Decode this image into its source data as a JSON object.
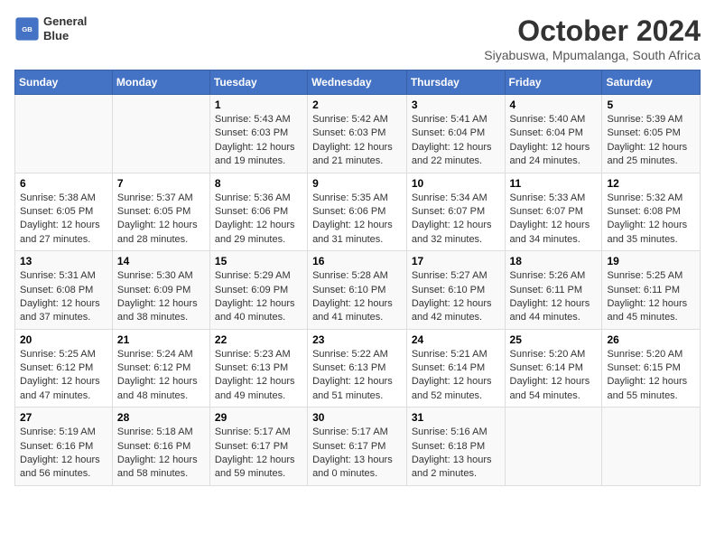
{
  "logo": {
    "line1": "General",
    "line2": "Blue"
  },
  "title": "October 2024",
  "subtitle": "Siyabuswa, Mpumalanga, South Africa",
  "weekdays": [
    "Sunday",
    "Monday",
    "Tuesday",
    "Wednesday",
    "Thursday",
    "Friday",
    "Saturday"
  ],
  "weeks": [
    [
      {
        "day": "",
        "info": ""
      },
      {
        "day": "",
        "info": ""
      },
      {
        "day": "1",
        "info": "Sunrise: 5:43 AM\nSunset: 6:03 PM\nDaylight: 12 hours\nand 19 minutes."
      },
      {
        "day": "2",
        "info": "Sunrise: 5:42 AM\nSunset: 6:03 PM\nDaylight: 12 hours\nand 21 minutes."
      },
      {
        "day": "3",
        "info": "Sunrise: 5:41 AM\nSunset: 6:04 PM\nDaylight: 12 hours\nand 22 minutes."
      },
      {
        "day": "4",
        "info": "Sunrise: 5:40 AM\nSunset: 6:04 PM\nDaylight: 12 hours\nand 24 minutes."
      },
      {
        "day": "5",
        "info": "Sunrise: 5:39 AM\nSunset: 6:05 PM\nDaylight: 12 hours\nand 25 minutes."
      }
    ],
    [
      {
        "day": "6",
        "info": "Sunrise: 5:38 AM\nSunset: 6:05 PM\nDaylight: 12 hours\nand 27 minutes."
      },
      {
        "day": "7",
        "info": "Sunrise: 5:37 AM\nSunset: 6:05 PM\nDaylight: 12 hours\nand 28 minutes."
      },
      {
        "day": "8",
        "info": "Sunrise: 5:36 AM\nSunset: 6:06 PM\nDaylight: 12 hours\nand 29 minutes."
      },
      {
        "day": "9",
        "info": "Sunrise: 5:35 AM\nSunset: 6:06 PM\nDaylight: 12 hours\nand 31 minutes."
      },
      {
        "day": "10",
        "info": "Sunrise: 5:34 AM\nSunset: 6:07 PM\nDaylight: 12 hours\nand 32 minutes."
      },
      {
        "day": "11",
        "info": "Sunrise: 5:33 AM\nSunset: 6:07 PM\nDaylight: 12 hours\nand 34 minutes."
      },
      {
        "day": "12",
        "info": "Sunrise: 5:32 AM\nSunset: 6:08 PM\nDaylight: 12 hours\nand 35 minutes."
      }
    ],
    [
      {
        "day": "13",
        "info": "Sunrise: 5:31 AM\nSunset: 6:08 PM\nDaylight: 12 hours\nand 37 minutes."
      },
      {
        "day": "14",
        "info": "Sunrise: 5:30 AM\nSunset: 6:09 PM\nDaylight: 12 hours\nand 38 minutes."
      },
      {
        "day": "15",
        "info": "Sunrise: 5:29 AM\nSunset: 6:09 PM\nDaylight: 12 hours\nand 40 minutes."
      },
      {
        "day": "16",
        "info": "Sunrise: 5:28 AM\nSunset: 6:10 PM\nDaylight: 12 hours\nand 41 minutes."
      },
      {
        "day": "17",
        "info": "Sunrise: 5:27 AM\nSunset: 6:10 PM\nDaylight: 12 hours\nand 42 minutes."
      },
      {
        "day": "18",
        "info": "Sunrise: 5:26 AM\nSunset: 6:11 PM\nDaylight: 12 hours\nand 44 minutes."
      },
      {
        "day": "19",
        "info": "Sunrise: 5:25 AM\nSunset: 6:11 PM\nDaylight: 12 hours\nand 45 minutes."
      }
    ],
    [
      {
        "day": "20",
        "info": "Sunrise: 5:25 AM\nSunset: 6:12 PM\nDaylight: 12 hours\nand 47 minutes."
      },
      {
        "day": "21",
        "info": "Sunrise: 5:24 AM\nSunset: 6:12 PM\nDaylight: 12 hours\nand 48 minutes."
      },
      {
        "day": "22",
        "info": "Sunrise: 5:23 AM\nSunset: 6:13 PM\nDaylight: 12 hours\nand 49 minutes."
      },
      {
        "day": "23",
        "info": "Sunrise: 5:22 AM\nSunset: 6:13 PM\nDaylight: 12 hours\nand 51 minutes."
      },
      {
        "day": "24",
        "info": "Sunrise: 5:21 AM\nSunset: 6:14 PM\nDaylight: 12 hours\nand 52 minutes."
      },
      {
        "day": "25",
        "info": "Sunrise: 5:20 AM\nSunset: 6:14 PM\nDaylight: 12 hours\nand 54 minutes."
      },
      {
        "day": "26",
        "info": "Sunrise: 5:20 AM\nSunset: 6:15 PM\nDaylight: 12 hours\nand 55 minutes."
      }
    ],
    [
      {
        "day": "27",
        "info": "Sunrise: 5:19 AM\nSunset: 6:16 PM\nDaylight: 12 hours\nand 56 minutes."
      },
      {
        "day": "28",
        "info": "Sunrise: 5:18 AM\nSunset: 6:16 PM\nDaylight: 12 hours\nand 58 minutes."
      },
      {
        "day": "29",
        "info": "Sunrise: 5:17 AM\nSunset: 6:17 PM\nDaylight: 12 hours\nand 59 minutes."
      },
      {
        "day": "30",
        "info": "Sunrise: 5:17 AM\nSunset: 6:17 PM\nDaylight: 13 hours\nand 0 minutes."
      },
      {
        "day": "31",
        "info": "Sunrise: 5:16 AM\nSunset: 6:18 PM\nDaylight: 13 hours\nand 2 minutes."
      },
      {
        "day": "",
        "info": ""
      },
      {
        "day": "",
        "info": ""
      }
    ]
  ]
}
